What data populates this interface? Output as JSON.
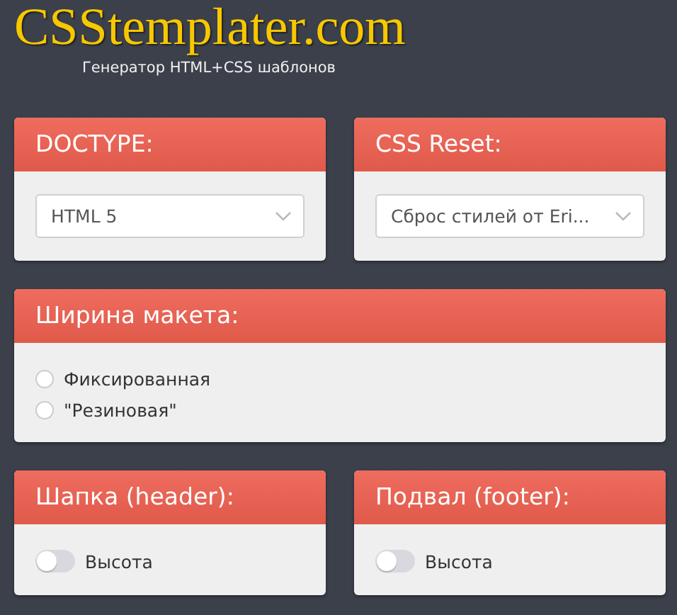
{
  "logo": {
    "title": "CSStemplater.com",
    "subtitle": "Генератор HTML+CSS шаблонов"
  },
  "panels": [
    {
      "kind": "select",
      "title": "DOCTYPE:",
      "value": "HTML 5"
    },
    {
      "kind": "select",
      "title": "CSS Reset:",
      "value": "Сброс стилей от Eri..."
    },
    {
      "kind": "radio",
      "title": "Ширина макета:",
      "options": [
        {
          "label": "Фиксированная",
          "selected": false
        },
        {
          "label": "\"Резиновая\"",
          "selected": false
        }
      ]
    },
    {
      "kind": "toggle",
      "title": "Шапка (header):",
      "label": "Высота",
      "on": false
    },
    {
      "kind": "toggle",
      "title": "Подвал (footer):",
      "label": "Высота",
      "on": false
    }
  ]
}
